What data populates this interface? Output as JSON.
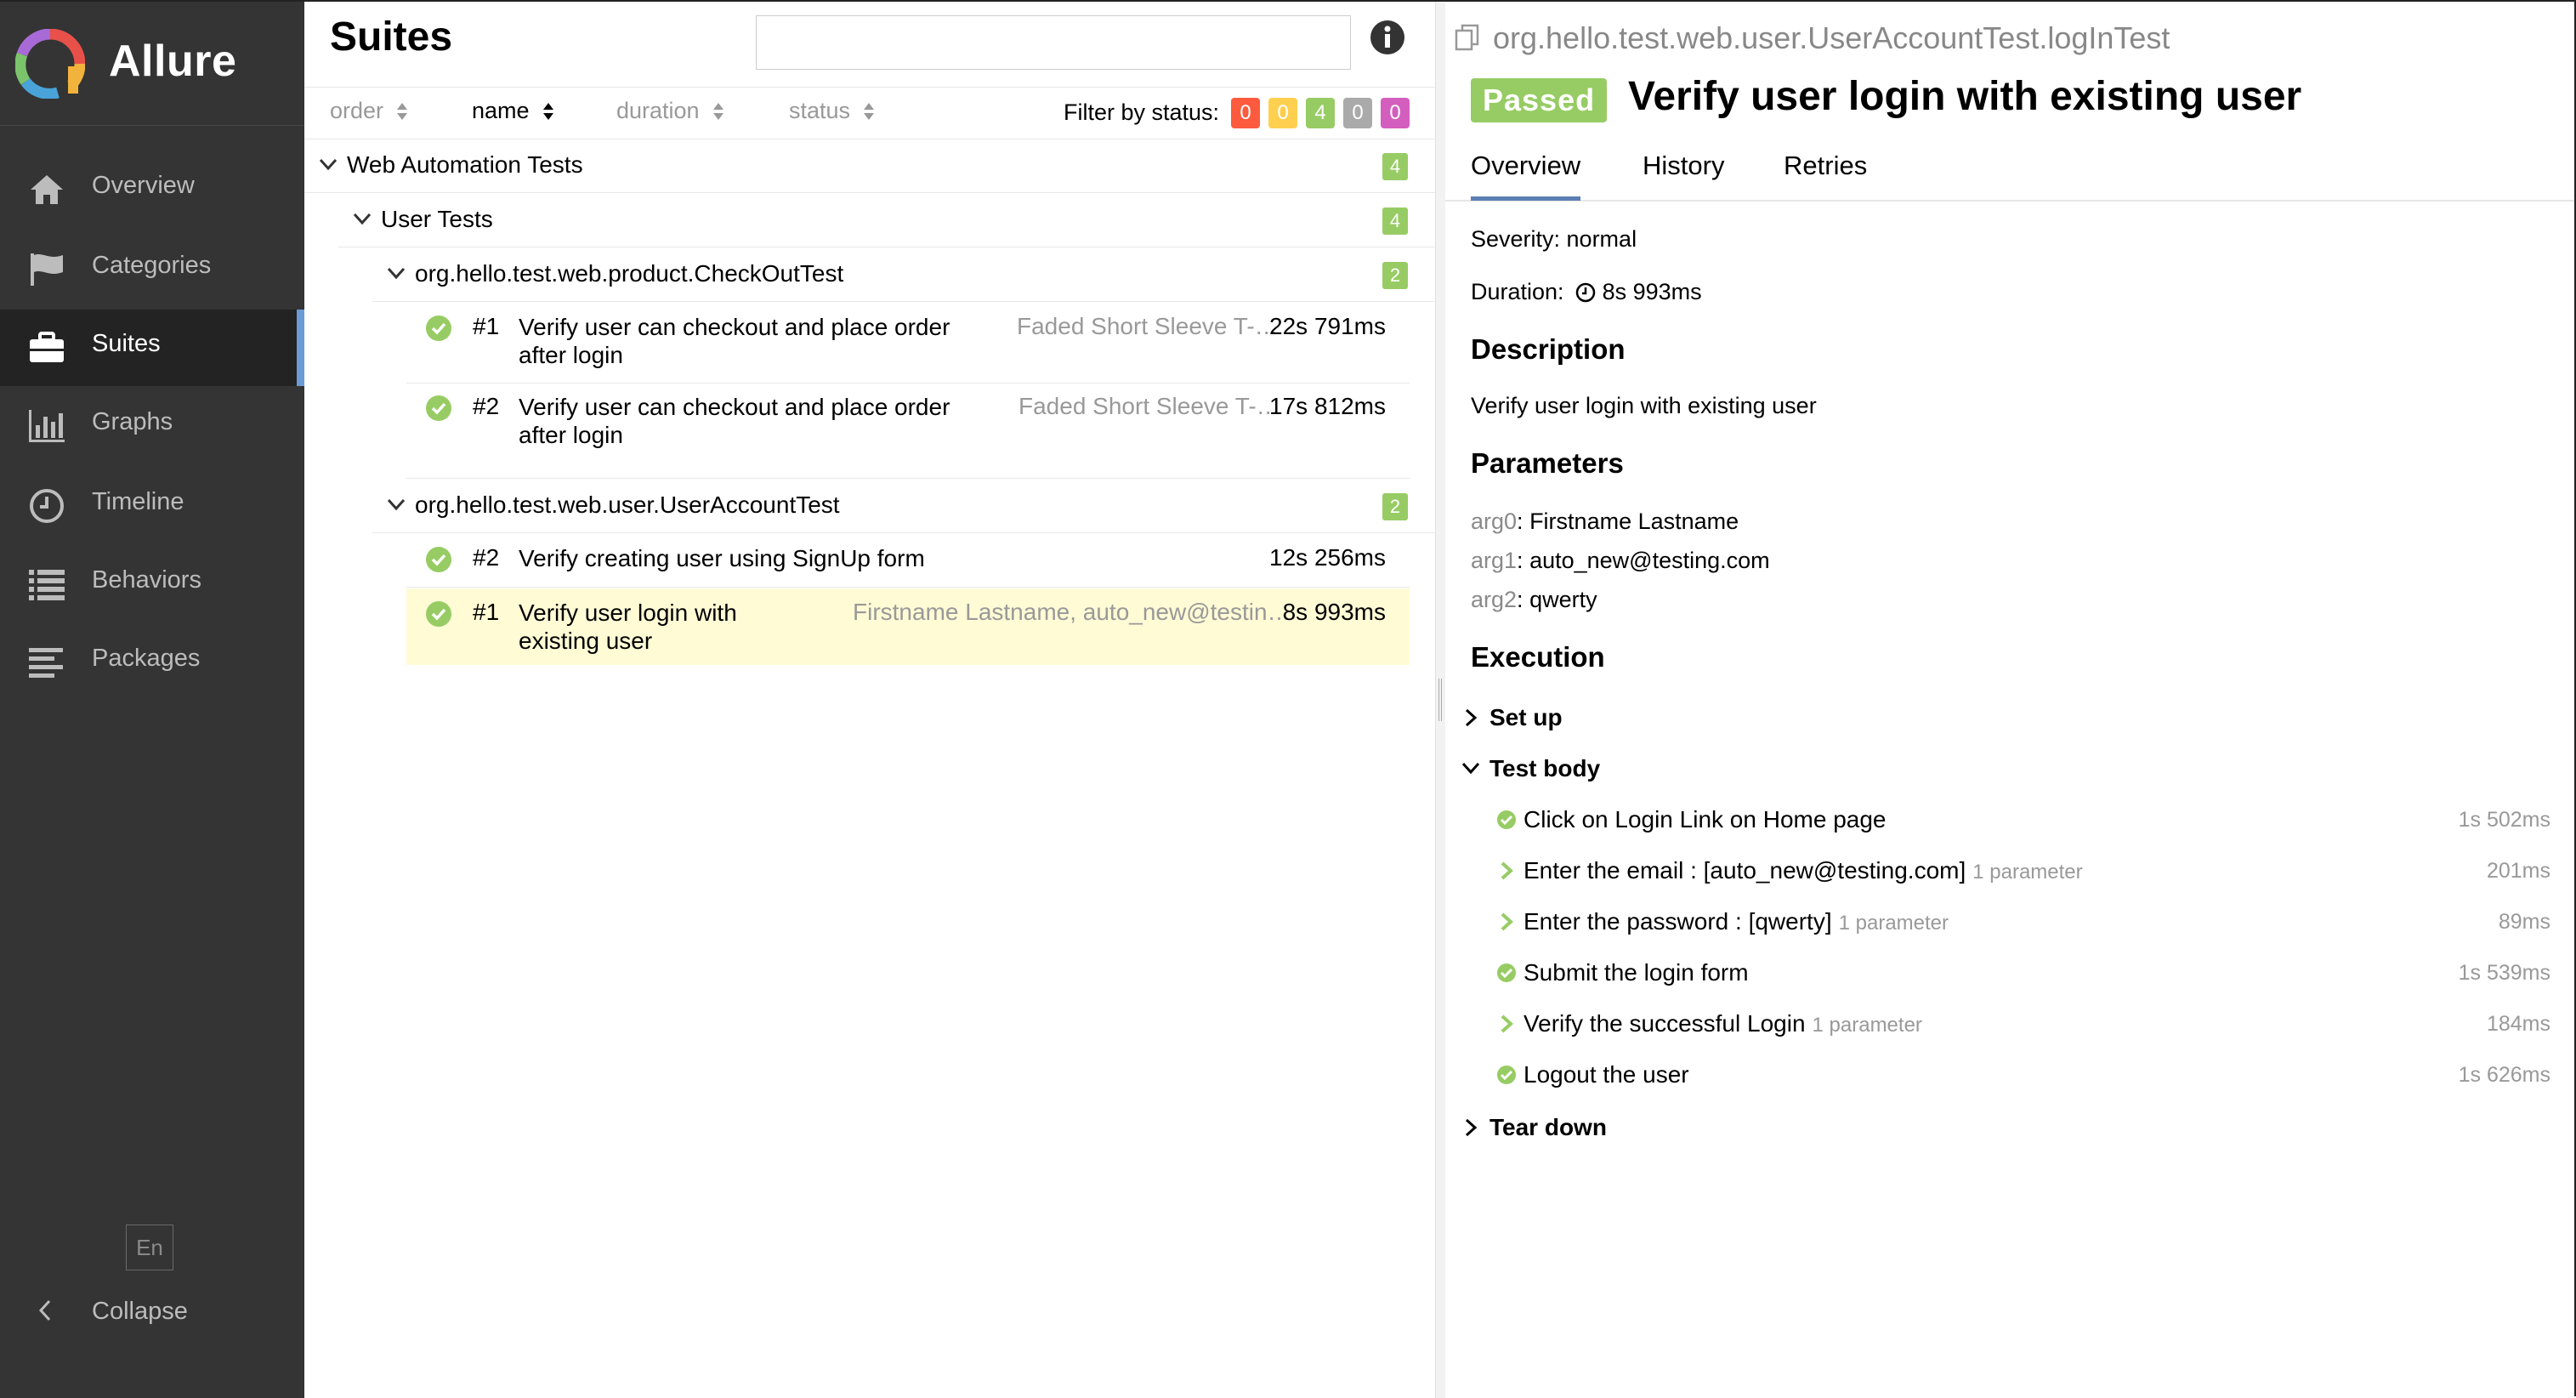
{
  "sidebar": {
    "brand": "Allure",
    "items": [
      {
        "label": "Overview",
        "icon": "home-icon"
      },
      {
        "label": "Categories",
        "icon": "flag-icon"
      },
      {
        "label": "Suites",
        "icon": "briefcase-icon",
        "active": true
      },
      {
        "label": "Graphs",
        "icon": "bar-chart-icon"
      },
      {
        "label": "Timeline",
        "icon": "clock-icon"
      },
      {
        "label": "Behaviors",
        "icon": "list-icon"
      },
      {
        "label": "Packages",
        "icon": "align-left-icon"
      }
    ],
    "language": "En",
    "collapse_label": "Collapse"
  },
  "suites": {
    "title": "Suites",
    "search_value": "",
    "sort": {
      "order": "order",
      "name": "name",
      "duration": "duration",
      "status": "status",
      "active": "name"
    },
    "filter_label": "Filter by status:",
    "status_filters": [
      {
        "status": "failed",
        "count": "0",
        "color": "#fd5a3e"
      },
      {
        "status": "broken",
        "count": "0",
        "color": "#ffd050"
      },
      {
        "status": "passed",
        "count": "4",
        "color": "#97cc64"
      },
      {
        "status": "skipped",
        "count": "0",
        "color": "#aaaaaa"
      },
      {
        "status": "unknown",
        "count": "0",
        "color": "#d35ebe"
      }
    ],
    "tree": {
      "root": {
        "label": "Web Automation Tests",
        "count": "4"
      },
      "group": {
        "label": "User Tests",
        "count": "4"
      },
      "checkout": {
        "label": "org.hello.test.web.product.CheckOutTest",
        "count": "2",
        "tests": [
          {
            "num": "#1",
            "name": "Verify user can checkout and place order after login",
            "params": "Faded Short Sleeve T-…",
            "duration": "22s 791ms"
          },
          {
            "num": "#2",
            "name": "Verify user can checkout and place order after login",
            "params": "Faded Short Sleeve T-…",
            "duration": "17s 812ms"
          }
        ]
      },
      "account": {
        "label": "org.hello.test.web.user.UserAccountTest",
        "count": "2",
        "tests": [
          {
            "num": "#2",
            "name": "Verify creating user using SignUp form",
            "params": "",
            "duration": "12s 256ms"
          },
          {
            "num": "#1",
            "name": "Verify user login with existing user",
            "params": "Firstname Lastname, auto_new@testin…",
            "duration": "8s 993ms",
            "selected": true
          }
        ]
      }
    }
  },
  "detail": {
    "path": "org.hello.test.web.user.UserAccountTest.logInTest",
    "status": "Passed",
    "title": "Verify user login with existing user",
    "tabs": [
      "Overview",
      "History",
      "Retries"
    ],
    "severity": "Severity: normal",
    "duration_label": "Duration:",
    "duration": "8s 993ms",
    "description_heading": "Description",
    "description": "Verify user login with existing user",
    "parameters_heading": "Parameters",
    "parameters": [
      {
        "name": "arg0",
        "value": "Firstname Lastname"
      },
      {
        "name": "arg1",
        "value": "auto_new@testing.com"
      },
      {
        "name": "arg2",
        "value": "qwerty"
      }
    ],
    "execution_heading": "Execution",
    "setup": "Set up",
    "test_body": "Test body",
    "steps": [
      {
        "name": "Click on Login Link on Home page",
        "param": "",
        "duration": "1s 502ms",
        "icon": "check"
      },
      {
        "name": "Enter the email : [auto_new@testing.com]",
        "param": "1 parameter",
        "duration": "201ms",
        "icon": "chevron"
      },
      {
        "name": "Enter the password : [qwerty]",
        "param": "1 parameter",
        "duration": "89ms",
        "icon": "chevron"
      },
      {
        "name": "Submit the login form",
        "param": "",
        "duration": "1s 539ms",
        "icon": "check"
      },
      {
        "name": "Verify the successful Login",
        "param": "1 parameter",
        "duration": "184ms",
        "icon": "chevron"
      },
      {
        "name": "Logout the user",
        "param": "",
        "duration": "1s 626ms",
        "icon": "check"
      }
    ],
    "teardown": "Tear down"
  },
  "colors": {
    "passed": "#97cc64",
    "sidebar_bg": "#343434",
    "accent": "#6b9bd6",
    "selected_row": "#fffbd5"
  }
}
